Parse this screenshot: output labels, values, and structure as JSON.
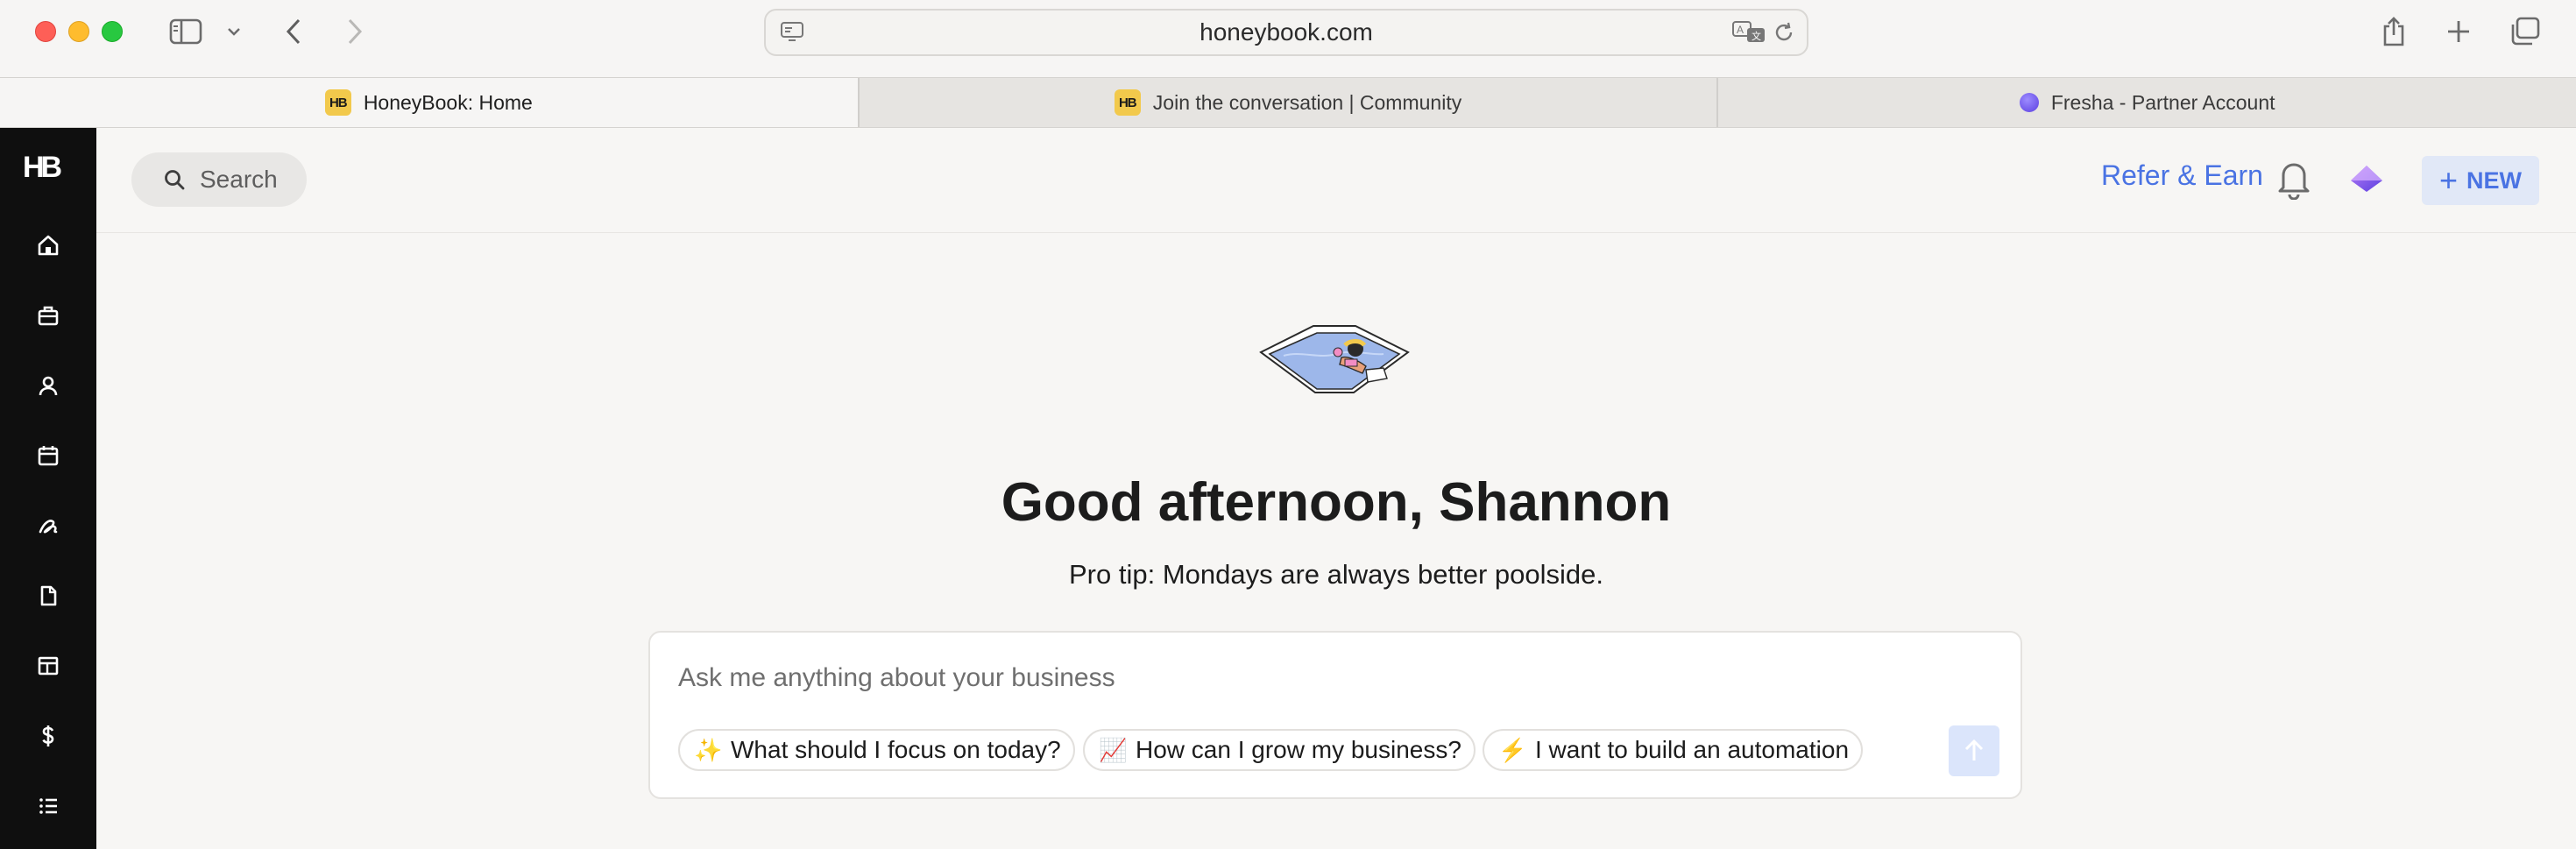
{
  "browser": {
    "url": "honeybook.com",
    "tabs": [
      {
        "title": "HoneyBook: Home",
        "favicon": "HB",
        "active": true
      },
      {
        "title": "Join the conversation | Community",
        "favicon": "HB",
        "active": false
      },
      {
        "title": "Fresha - Partner Account",
        "favicon": "fresha-dot",
        "active": false
      }
    ]
  },
  "sidebar": {
    "logo": "HB",
    "items": [
      {
        "icon": "home-icon"
      },
      {
        "icon": "briefcase-icon"
      },
      {
        "icon": "person-icon"
      },
      {
        "icon": "calendar-icon"
      },
      {
        "icon": "signature-icon"
      },
      {
        "icon": "document-icon"
      },
      {
        "icon": "template-icon"
      },
      {
        "icon": "dollar-icon"
      },
      {
        "icon": "list-icon"
      }
    ]
  },
  "header": {
    "search_label": "Search",
    "refer_label": "Refer & Earn",
    "new_label": "NEW",
    "new_icon": "+"
  },
  "main": {
    "greeting": "Good afternoon, Shannon",
    "tip": "Pro tip: Mondays are always better poolside.",
    "ask_placeholder": "Ask me anything about your business",
    "suggestions": [
      {
        "emoji": "✨",
        "label": "What should I focus on today?"
      },
      {
        "emoji": "📈",
        "label": "How can I grow my business?"
      },
      {
        "emoji": "⚡",
        "label": "I want to build an automation"
      }
    ]
  },
  "colors": {
    "accent": "#4a73e3",
    "sidebar_bg": "#0f0f0f",
    "page_bg": "#f7f6f4",
    "hb_favicon": "#f2c94c"
  }
}
